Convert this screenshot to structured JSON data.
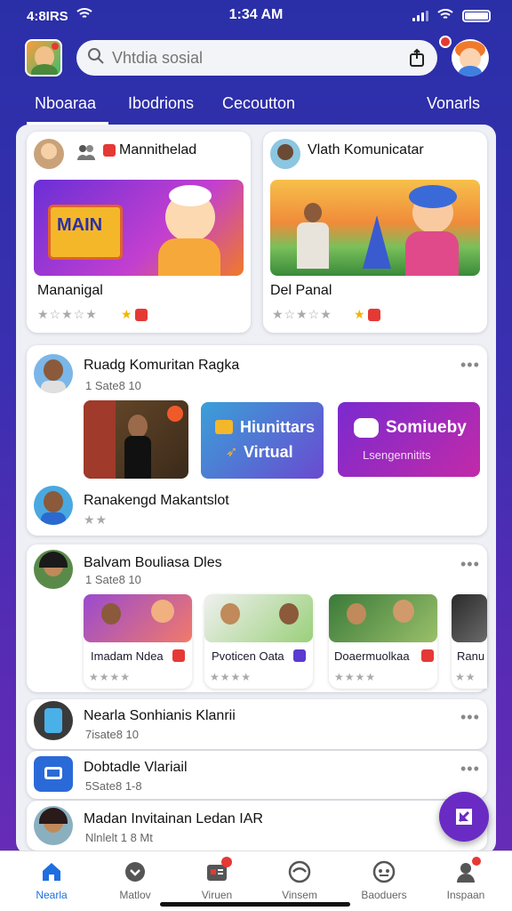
{
  "status": {
    "carrier": "4:8IRS",
    "time": "1:34 AM"
  },
  "search": {
    "placeholder": "Vhtdia sosial"
  },
  "tabs": [
    "Nboaraa",
    "Ibodrions",
    "Cecoutton",
    "Vonarls"
  ],
  "top_cards": [
    {
      "header": "Mannithelad",
      "title": "Mananigal"
    },
    {
      "header": "Vlath Komunicatar",
      "title": "Del Panal"
    }
  ],
  "community": {
    "title": "Ruadg Komuritan Ragka",
    "meta": "1 Sate8 10",
    "tile1_title": "Hiunittars",
    "tile1_sub": "Virtual",
    "tile2_title": "Somiueby",
    "tile2_sub": "Lsengennitits",
    "footer": "Ranakengd Makantslot"
  },
  "post2": {
    "title": "Balvam Bouliasa Dles",
    "meta": "1 Sate8 10",
    "items": [
      "Imadam Ndea",
      "Pvoticen Oata",
      "Doaermuolkaa",
      "Ranu"
    ]
  },
  "list": [
    {
      "title": "Nearla Sonhianis Klanrii",
      "meta": "7isate8 10"
    },
    {
      "title": "Dobtadle Vlariail",
      "meta": "5Sate8 1-8"
    },
    {
      "title": "Madan Invitainan Ledan IAR",
      "meta": "Nlnlelt 1 8 Mt"
    }
  ],
  "bottom_nav": [
    "Nearla",
    "Matlov",
    "Viruen",
    "Vinsem",
    "Baoduers",
    "Inspaan"
  ],
  "colors": {
    "primary": "#2a2fa8",
    "accent": "#1e6fe0",
    "fab": "#6a2bc4"
  }
}
